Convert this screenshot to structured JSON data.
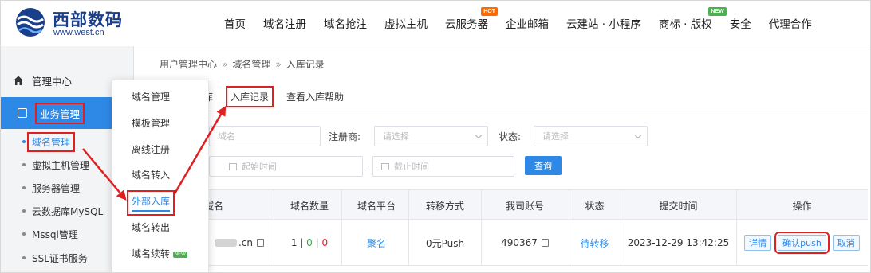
{
  "header": {
    "logo_cn": "西部数码",
    "logo_url": "www.west.cn",
    "nav": [
      {
        "label": "首页"
      },
      {
        "label": "域名注册"
      },
      {
        "label": "域名抢注"
      },
      {
        "label": "虚拟主机"
      },
      {
        "label": "云服务器",
        "badge": "HOT"
      },
      {
        "label": "企业邮箱"
      },
      {
        "label": "云建站 · 小程序"
      },
      {
        "label": "商标 · 版权",
        "badge": "NEW"
      },
      {
        "label": "安全"
      },
      {
        "label": "代理合作"
      }
    ]
  },
  "sidebar": {
    "home": "管理中心",
    "business": "业务管理",
    "items": [
      "域名管理",
      "虚拟主机管理",
      "服务器管理",
      "云数据库MySQL",
      "Mssql管理",
      "SSL证书服务"
    ]
  },
  "flyout": {
    "items": [
      "域名管理",
      "模板管理",
      "离线注册",
      "域名转入",
      "外部入库",
      "域名转出",
      "域名续转"
    ],
    "new_tag": "NEW"
  },
  "breadcrumb": [
    "用户管理中心",
    "域名管理",
    "入库记录"
  ],
  "breadcrumb_sep": "»",
  "tabs": [
    "库",
    "入库记录",
    "查看入库帮助"
  ],
  "filters": {
    "domain_placeholder": "域名",
    "registrar_label": "注册商:",
    "registrar_placeholder": "请选择",
    "status_label": "状态:",
    "status_placeholder": "请选择",
    "start_placeholder": "起始时间",
    "range_sep": "-",
    "end_placeholder": "截止时间",
    "query_button": "查询"
  },
  "table": {
    "headers": [
      "域名",
      "域名数量",
      "域名平台",
      "转移方式",
      "我司账号",
      "状态",
      "提交时间",
      "操作"
    ],
    "row": {
      "domain_suffix": ".cn",
      "count_total": "1",
      "count_sep": "|",
      "count_ok": "0",
      "count_fail": "0",
      "platform": "聚名",
      "method": "0元Push",
      "account": "490367",
      "status": "待转移",
      "time": "2023-12-29 13:42:25",
      "actions": [
        "详情",
        "确认push",
        "取消"
      ]
    }
  },
  "colors": {
    "accent": "#2e89e6",
    "annotation": "#e02020"
  }
}
